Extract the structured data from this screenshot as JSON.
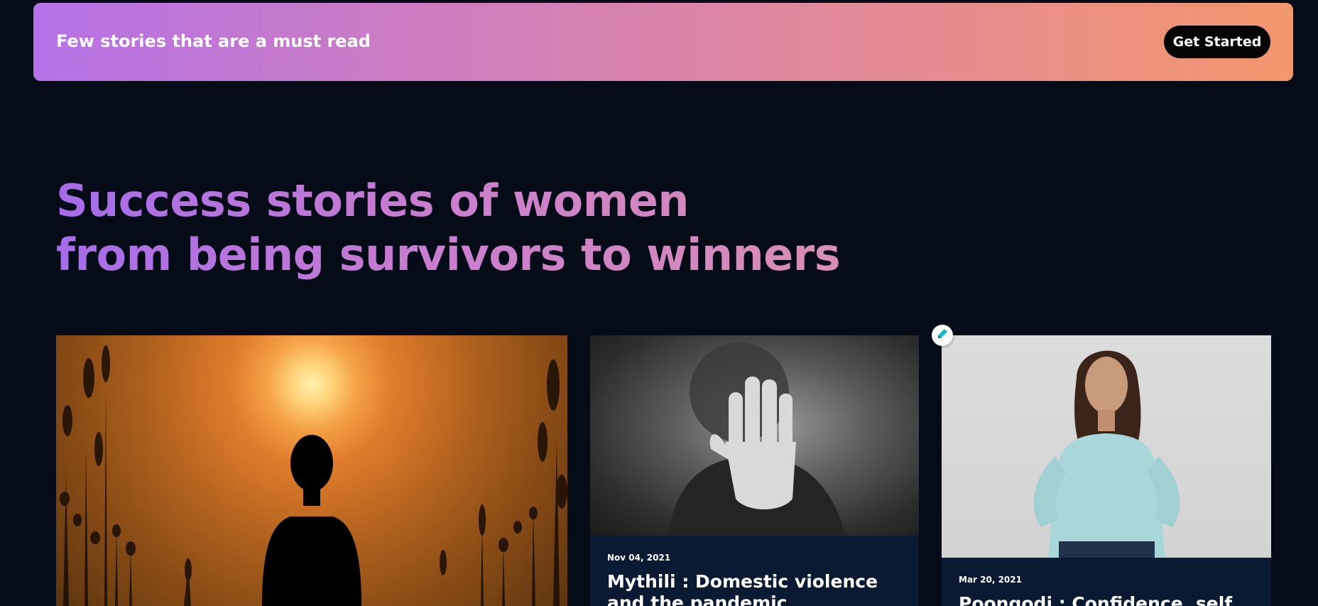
{
  "banner": {
    "text": "Few stories that are a must read",
    "button_label": "Get Started"
  },
  "headline": {
    "line1": "Success stories of women",
    "line2": "from being survivors to winners"
  },
  "cards": [
    {
      "image": "meditation-silhouette-sunset-image",
      "date": "",
      "title": ""
    },
    {
      "image": "hand-stop-gesture-image",
      "date": "Nov 04, 2021",
      "title": "Mythili : Domestic violence and the pandemic"
    },
    {
      "image": "smiling-woman-portrait-image",
      "date": "Mar 20, 2021",
      "title": "Poongodi : Confidence, self, self-"
    }
  ],
  "colors": {
    "background": "#050c17",
    "banner_gradient_start": "#b671e6",
    "banner_gradient_end": "#f2976d",
    "card_body": "#0a1a33",
    "button": "#050505"
  },
  "icons": {
    "edit_badge": "pen-edit-icon"
  }
}
